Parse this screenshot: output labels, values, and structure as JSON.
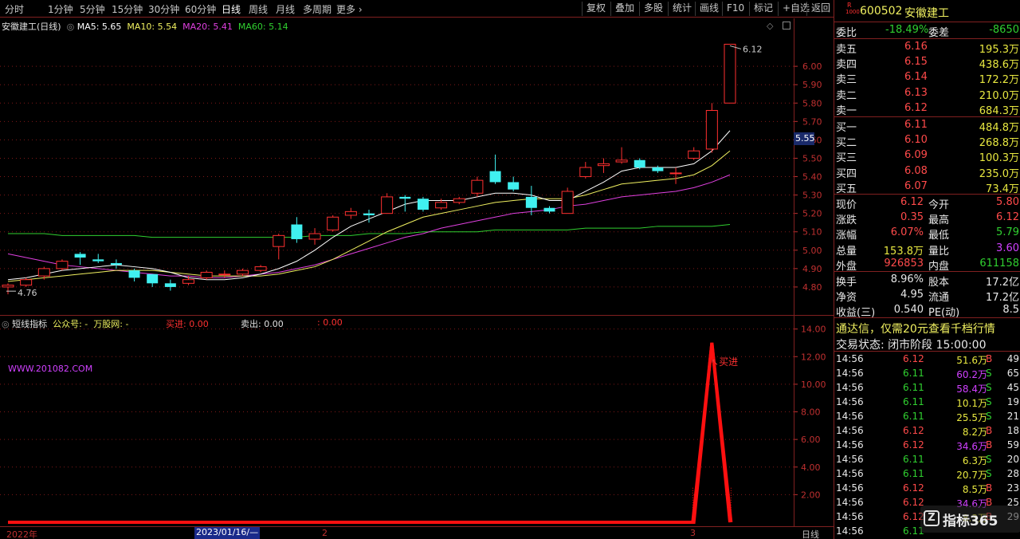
{
  "toolbar": {
    "periods": [
      "分时",
      "1分钟",
      "5分钟",
      "15分钟",
      "30分钟",
      "60分钟",
      "日线",
      "周线",
      "月线",
      "多周期",
      "更多"
    ],
    "active_period": "日线",
    "right_buttons": [
      "复权",
      "叠加",
      "多股",
      "统计",
      "画线",
      "F10",
      "标记",
      "+自选",
      "返回"
    ]
  },
  "main_chart": {
    "title": "安徽建工(日线)",
    "ma5": "MA5: 5.65",
    "ma10": "MA10: 5.54",
    "ma20": "MA20: 5.41",
    "ma60": "MA60: 5.14",
    "high_label": "6.12",
    "low_label": "4.76",
    "current_price_tag": "5.55"
  },
  "chart_data": {
    "type": "candlestick",
    "price_axis": {
      "min": 4.7,
      "max": 6.2,
      "ticks": [
        "6.00",
        "5.90",
        "5.80",
        "5.70",
        "5.60",
        "5.50",
        "5.40",
        "5.30",
        "5.20",
        "5.10",
        "5.00",
        "4.90",
        "4.80"
      ]
    },
    "candles": [
      {
        "o": 4.8,
        "c": 4.81,
        "h": 4.82,
        "l": 4.76
      },
      {
        "o": 4.81,
        "c": 4.84,
        "h": 4.85,
        "l": 4.8
      },
      {
        "o": 4.86,
        "c": 4.9,
        "h": 4.91,
        "l": 4.84
      },
      {
        "o": 4.9,
        "c": 4.94,
        "h": 4.95,
        "l": 4.89
      },
      {
        "o": 4.98,
        "c": 4.96,
        "h": 4.99,
        "l": 4.92
      },
      {
        "o": 4.95,
        "c": 4.94,
        "h": 4.98,
        "l": 4.93
      },
      {
        "o": 4.93,
        "c": 4.92,
        "h": 4.95,
        "l": 4.9
      },
      {
        "o": 4.89,
        "c": 4.85,
        "h": 4.9,
        "l": 4.83
      },
      {
        "o": 4.87,
        "c": 4.82,
        "h": 4.87,
        "l": 4.8
      },
      {
        "o": 4.82,
        "c": 4.8,
        "h": 4.84,
        "l": 4.78
      },
      {
        "o": 4.82,
        "c": 4.84,
        "h": 4.86,
        "l": 4.81
      },
      {
        "o": 4.85,
        "c": 4.88,
        "h": 4.89,
        "l": 4.84
      },
      {
        "o": 4.87,
        "c": 4.87,
        "h": 4.89,
        "l": 4.85
      },
      {
        "o": 4.87,
        "c": 4.89,
        "h": 4.9,
        "l": 4.86
      },
      {
        "o": 4.89,
        "c": 4.91,
        "h": 4.92,
        "l": 4.88
      },
      {
        "o": 5.02,
        "c": 5.08,
        "h": 5.09,
        "l": 4.95
      },
      {
        "o": 5.14,
        "c": 5.06,
        "h": 5.18,
        "l": 5.04
      },
      {
        "o": 5.06,
        "c": 5.09,
        "h": 5.12,
        "l": 5.03
      },
      {
        "o": 5.11,
        "c": 5.18,
        "h": 5.19,
        "l": 5.1
      },
      {
        "o": 5.19,
        "c": 5.21,
        "h": 5.23,
        "l": 5.17
      },
      {
        "o": 5.2,
        "c": 5.19,
        "h": 5.22,
        "l": 5.15
      },
      {
        "o": 5.2,
        "c": 5.29,
        "h": 5.31,
        "l": 5.2
      },
      {
        "o": 5.29,
        "c": 5.28,
        "h": 5.3,
        "l": 5.21
      },
      {
        "o": 5.28,
        "c": 5.22,
        "h": 5.29,
        "l": 5.21
      },
      {
        "o": 5.23,
        "c": 5.26,
        "h": 5.28,
        "l": 5.22
      },
      {
        "o": 5.26,
        "c": 5.28,
        "h": 5.29,
        "l": 5.25
      },
      {
        "o": 5.31,
        "c": 5.38,
        "h": 5.4,
        "l": 5.29
      },
      {
        "o": 5.43,
        "c": 5.37,
        "h": 5.52,
        "l": 5.36
      },
      {
        "o": 5.37,
        "c": 5.33,
        "h": 5.4,
        "l": 5.32
      },
      {
        "o": 5.29,
        "c": 5.23,
        "h": 5.35,
        "l": 5.19
      },
      {
        "o": 5.23,
        "c": 5.21,
        "h": 5.24,
        "l": 5.2
      },
      {
        "o": 5.2,
        "c": 5.32,
        "h": 5.34,
        "l": 5.2
      },
      {
        "o": 5.4,
        "c": 5.45,
        "h": 5.48,
        "l": 5.39
      },
      {
        "o": 5.46,
        "c": 5.47,
        "h": 5.5,
        "l": 5.42
      },
      {
        "o": 5.48,
        "c": 5.49,
        "h": 5.56,
        "l": 5.47
      },
      {
        "o": 5.49,
        "c": 5.45,
        "h": 5.5,
        "l": 5.44
      },
      {
        "o": 5.45,
        "c": 5.43,
        "h": 5.46,
        "l": 5.42
      },
      {
        "o": 5.42,
        "c": 5.42,
        "h": 5.45,
        "l": 5.36
      },
      {
        "o": 5.5,
        "c": 5.54,
        "h": 5.56,
        "l": 5.49
      },
      {
        "o": 5.55,
        "c": 5.76,
        "h": 5.8,
        "l": 5.53
      },
      {
        "o": 5.8,
        "c": 6.12,
        "h": 6.12,
        "l": 5.8
      }
    ],
    "ma5": [
      4.84,
      4.85,
      4.87,
      4.89,
      4.9,
      4.91,
      4.92,
      4.91,
      4.9,
      4.88,
      4.85,
      4.84,
      4.84,
      4.85,
      4.87,
      4.9,
      4.94,
      5.0,
      5.07,
      5.13,
      5.17,
      5.21,
      5.25,
      5.27,
      5.27,
      5.27,
      5.29,
      5.31,
      5.31,
      5.3,
      5.27,
      5.27,
      5.32,
      5.37,
      5.43,
      5.45,
      5.45,
      5.45,
      5.47,
      5.54,
      5.65
    ],
    "ma10": [
      4.83,
      4.84,
      4.85,
      4.86,
      4.87,
      4.88,
      4.89,
      4.89,
      4.89,
      4.88,
      4.87,
      4.86,
      4.86,
      4.86,
      4.86,
      4.87,
      4.89,
      4.91,
      4.95,
      5.0,
      5.05,
      5.1,
      5.14,
      5.18,
      5.2,
      5.22,
      5.24,
      5.26,
      5.27,
      5.28,
      5.28,
      5.28,
      5.3,
      5.33,
      5.36,
      5.37,
      5.38,
      5.39,
      5.41,
      5.46,
      5.54
    ],
    "ma20": [
      4.98,
      4.96,
      4.94,
      4.92,
      4.91,
      4.9,
      4.89,
      4.88,
      4.87,
      4.86,
      4.86,
      4.85,
      4.85,
      4.86,
      4.87,
      4.88,
      4.9,
      4.92,
      4.95,
      4.98,
      5.01,
      5.04,
      5.07,
      5.09,
      5.12,
      5.14,
      5.16,
      5.18,
      5.2,
      5.21,
      5.22,
      5.24,
      5.25,
      5.27,
      5.29,
      5.3,
      5.31,
      5.32,
      5.34,
      5.37,
      5.41
    ],
    "ma60": [
      5.09,
      5.09,
      5.09,
      5.08,
      5.08,
      5.08,
      5.08,
      5.08,
      5.07,
      5.07,
      5.07,
      5.07,
      5.07,
      5.07,
      5.07,
      5.07,
      5.07,
      5.08,
      5.08,
      5.08,
      5.09,
      5.09,
      5.09,
      5.1,
      5.1,
      5.1,
      5.1,
      5.11,
      5.11,
      5.11,
      5.11,
      5.11,
      5.12,
      5.12,
      5.12,
      5.12,
      5.13,
      5.13,
      5.13,
      5.13,
      5.14
    ],
    "indicator_axis": {
      "min": 0,
      "max": 14.5,
      "ticks": [
        "14.00",
        "12.00",
        "10.00",
        "8.00",
        "6.00",
        "4.00",
        "2.00"
      ]
    },
    "indicator_peak": 13.0,
    "indicator_values": [
      0,
      0,
      0,
      0,
      0,
      0,
      0,
      0,
      0,
      0,
      0,
      0,
      0,
      0,
      0,
      0,
      0,
      0,
      0,
      0,
      0,
      0,
      0,
      0,
      0,
      0,
      0,
      0,
      0,
      0,
      0,
      0,
      0,
      0,
      0,
      0,
      0,
      0,
      0,
      13.0,
      0
    ]
  },
  "indicator": {
    "name": "短线指标",
    "gzh": "公众号: -",
    "wz": "万股网: -",
    "buy_label": "买进: 0.00",
    "sell_label": "卖出: 0.00",
    "extra": ": 0.00",
    "website": "WWW.201082.COM",
    "signal_text": "买进"
  },
  "time_axis": {
    "labels": [
      "2022年",
      "2023/01/16/—",
      "2",
      "3"
    ],
    "period_label": "日线"
  },
  "quote": {
    "code": "600502",
    "name": "安徽建工",
    "weibi_label": "委比",
    "weibi_value": "-18.49%",
    "weicha_label": "委差",
    "weicha_value": "-8650",
    "asks": [
      {
        "label": "卖五",
        "price": "6.16",
        "vol": "195.3万"
      },
      {
        "label": "卖四",
        "price": "6.15",
        "vol": "438.6万"
      },
      {
        "label": "卖三",
        "price": "6.14",
        "vol": "172.2万"
      },
      {
        "label": "卖二",
        "price": "6.13",
        "vol": "210.0万"
      },
      {
        "label": "卖一",
        "price": "6.12",
        "vol": "684.3万"
      }
    ],
    "bids": [
      {
        "label": "买一",
        "price": "6.11",
        "vol": "484.8万"
      },
      {
        "label": "买二",
        "price": "6.10",
        "vol": "268.8万"
      },
      {
        "label": "买三",
        "price": "6.09",
        "vol": "100.3万"
      },
      {
        "label": "买四",
        "price": "6.08",
        "vol": "235.0万"
      },
      {
        "label": "买五",
        "price": "6.07",
        "vol": "73.4万"
      }
    ],
    "stats": [
      {
        "l1": "现价",
        "v1": "6.12",
        "l2": "今开",
        "v2": "5.80"
      },
      {
        "l1": "涨跌",
        "v1": "0.35",
        "l2": "最高",
        "v2": "6.12"
      },
      {
        "l1": "涨幅",
        "v1": "6.07%",
        "l2": "最低",
        "v2": "5.79"
      },
      {
        "l1": "总量",
        "v1": "153.8万",
        "l2": "量比",
        "v2": "3.60"
      },
      {
        "l1": "外盘",
        "v1": "926853",
        "l2": "内盘",
        "v2": "611158"
      }
    ],
    "stats2": [
      {
        "l1": "换手",
        "v1": "8.96%",
        "l2": "股本",
        "v2": "17.2亿"
      },
      {
        "l1": "净资",
        "v1": "4.95",
        "l2": "流通",
        "v2": "17.2亿"
      },
      {
        "l1": "收益(三)",
        "v1": "0.540",
        "l2": "PE(动)",
        "v2": "8.5"
      }
    ],
    "ad_text": "通达信，仅需20元查看千档行情",
    "status_text": "交易状态: 闭市阶段 15:00:00",
    "ticks": [
      {
        "t": "14:56",
        "p": "6.12",
        "v": "51.6万",
        "s": "B",
        "n": "49"
      },
      {
        "t": "14:56",
        "p": "6.11",
        "v": "60.2万",
        "s": "S",
        "n": "65"
      },
      {
        "t": "14:56",
        "p": "6.11",
        "v": "58.4万",
        "s": "S",
        "n": "45"
      },
      {
        "t": "14:56",
        "p": "6.11",
        "v": "10.1万",
        "s": "S",
        "n": "19"
      },
      {
        "t": "14:56",
        "p": "6.11",
        "v": "25.5万",
        "s": "S",
        "n": "21"
      },
      {
        "t": "14:56",
        "p": "6.12",
        "v": "8.2万",
        "s": "B",
        "n": "18"
      },
      {
        "t": "14:56",
        "p": "6.12",
        "v": "34.6万",
        "s": "B",
        "n": "59"
      },
      {
        "t": "14:56",
        "p": "6.11",
        "v": "6.3万",
        "s": "S",
        "n": "20"
      },
      {
        "t": "14:56",
        "p": "6.11",
        "v": "20.7万",
        "s": "S",
        "n": "28"
      },
      {
        "t": "14:56",
        "p": "6.12",
        "v": "8.5万",
        "s": "B",
        "n": "23"
      },
      {
        "t": "14:56",
        "p": "6.12",
        "v": "34.6万",
        "s": "B",
        "n": "25"
      },
      {
        "t": "14:56",
        "p": "6.12",
        "v": "8.3万",
        "s": "B",
        "n": "29"
      },
      {
        "t": "14:56",
        "p": "6.11",
        "v": "",
        "s": "",
        "n": ""
      }
    ],
    "watermark": "指标365"
  },
  "colors": {
    "up": "#ff3030",
    "down": "#40f0f0",
    "ma5": "#ffffff",
    "ma10": "#f0f060",
    "ma20": "#e040e0",
    "ma60": "#30d030",
    "grid": "#801818"
  }
}
